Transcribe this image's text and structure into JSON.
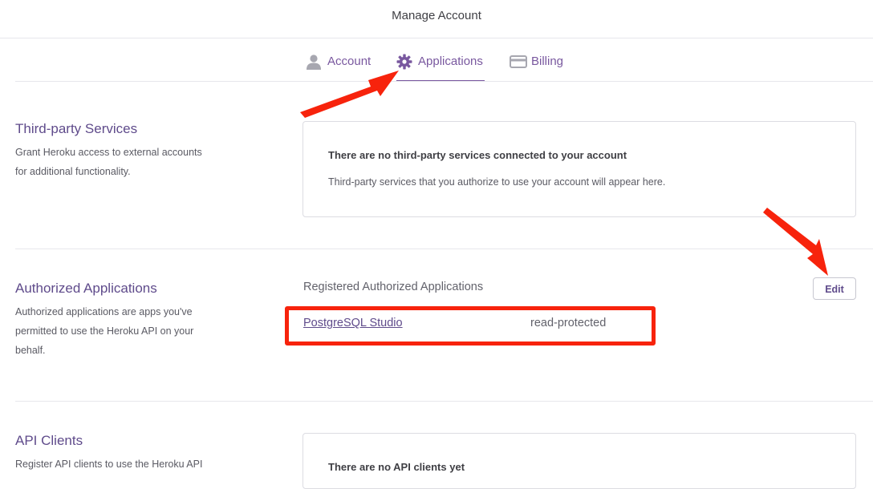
{
  "header": {
    "title": "Manage Account"
  },
  "tabs": [
    {
      "label": "Account",
      "icon": "person-icon",
      "active": false
    },
    {
      "label": "Applications",
      "icon": "gear-icon",
      "active": true
    },
    {
      "label": "Billing",
      "icon": "credit-card-icon",
      "active": false
    }
  ],
  "sections": {
    "third_party": {
      "title": "Third-party Services",
      "desc_line1": "Grant Heroku access to external accounts",
      "desc_line2": "for additional functionality.",
      "card_heading": "There are no third-party services connected to your account",
      "card_text": "Third-party services that you authorize to use your account will appear here."
    },
    "authorized": {
      "title": "Authorized Applications",
      "desc_line1": "Authorized applications are apps you've",
      "desc_line2": "permitted to use the Heroku API on your",
      "desc_line3": "behalf.",
      "list_label": "Registered Authorized Applications",
      "edit_label": "Edit",
      "apps": [
        {
          "name": "PostgreSQL Studio",
          "scope": "read-protected"
        }
      ]
    },
    "api_clients": {
      "title": "API Clients",
      "desc_line1": "Register API clients to use the Heroku API",
      "card_heading": "There are no API clients yet"
    }
  },
  "colors": {
    "accent": "#79589f",
    "title_purple": "#5f4b8b",
    "annotation_red": "#f7230c",
    "divider": "#e7e7ec"
  }
}
